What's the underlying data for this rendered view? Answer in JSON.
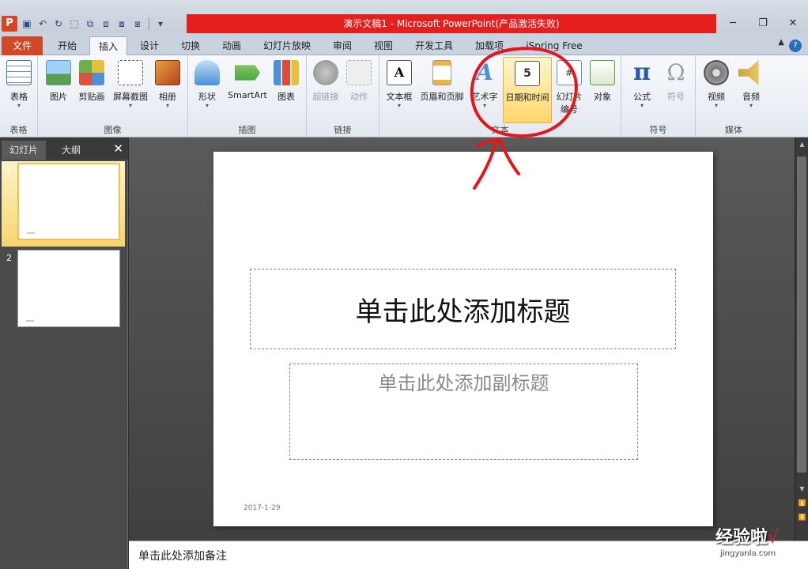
{
  "window": {
    "title": "演示文稿1 - Microsoft PowerPoint(产品激活失败)",
    "minimize": "─",
    "restore": "❐",
    "close": "✕"
  },
  "qat": {
    "logo": "P"
  },
  "tabs": {
    "file": "文件",
    "home": "开始",
    "insert": "插入",
    "design": "设计",
    "transitions": "切换",
    "animations": "动画",
    "slideshow": "幻灯片放映",
    "review": "审阅",
    "view": "视图",
    "developer": "开发工具",
    "addins": "加载项",
    "ispring": "iSpring Free"
  },
  "ribbon": {
    "groups": {
      "tables": "表格",
      "images": "图像",
      "illustrations": "插图",
      "links": "链接",
      "text": "文本",
      "symbols": "符号",
      "media": "媒体"
    },
    "buttons": {
      "table": "表格",
      "picture": "图片",
      "clipart": "剪贴画",
      "screenshot": "屏幕截图",
      "album": "相册",
      "shapes": "形状",
      "smartart": "SmartArt",
      "chart": "图表",
      "hyperlink": "超链接",
      "action": "动作",
      "textbox": "文本框",
      "header_footer": "页眉和页脚",
      "wordart": "艺术字",
      "datetime": "日期和时间",
      "slide_number": "幻灯片编号",
      "object": "对象",
      "equation": "公式",
      "symbol": "符号",
      "video": "视频",
      "audio": "音频"
    }
  },
  "left_pane": {
    "tab_slides": "幻灯片",
    "tab_outline": "大纲",
    "close": "✕",
    "slides": [
      "1",
      "2"
    ]
  },
  "slide": {
    "title_placeholder": "单击此处添加标题",
    "subtitle_placeholder": "单击此处添加副标题",
    "date": "2017-1-29"
  },
  "notes": {
    "placeholder": "单击此处添加备注"
  },
  "watermark": {
    "text": "经验啦",
    "check": "√",
    "url": "jingyanla.com"
  },
  "colors": {
    "accent": "#d24726",
    "title_bar_red": "#e51e1e",
    "annotation": "#e8141a"
  }
}
